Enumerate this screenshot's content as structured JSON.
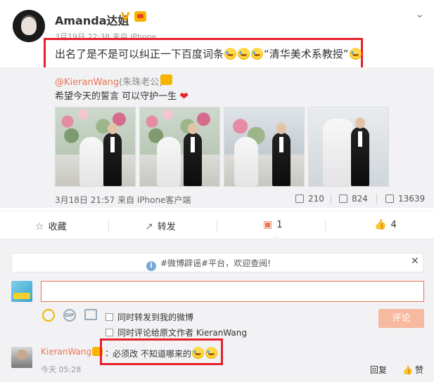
{
  "post": {
    "author": "Amanda达姐",
    "meta": "3月19日 22:38 来自 iPhone",
    "text": "出名了是不是可以纠正一下百度词条",
    "quote": "“清华美术系教授”"
  },
  "repost": {
    "user": "@KieranWang",
    "alias": "(朱珠老公)",
    "text": "希望今天的誓言 可以守护一生",
    "time": "3月18日 21:57 来自 iPhone客户端",
    "stats": {
      "reposts": "210",
      "comments": "824",
      "likes": "13639"
    }
  },
  "actions": {
    "favorite": "收藏",
    "forward": "转发",
    "comment": "1",
    "like": "4"
  },
  "notice": {
    "text": "#微博辟谣#平台，欢迎查阅!"
  },
  "composer": {
    "option_repost": "同时转发到我的微博",
    "option_comment_author": "同时评论给原文作者 KieranWang",
    "submit": "评论"
  },
  "comment": {
    "user": "KieranWang",
    "colon": "：",
    "text": "必须改 不知道哪来的",
    "time": "今天 05:28",
    "reply": "回复",
    "like": "赞"
  },
  "icons": {
    "more": "chevron-down-icon",
    "favorite": "star-icon",
    "forward": "forward-icon",
    "comment": "comment-icon",
    "like": "thumbs-up-icon",
    "info": "info-icon",
    "close": "close-icon"
  },
  "colors": {
    "highlight_box": "#e8202a",
    "accent": "#eb7350",
    "submit_disabled": "#f7b9a0"
  }
}
